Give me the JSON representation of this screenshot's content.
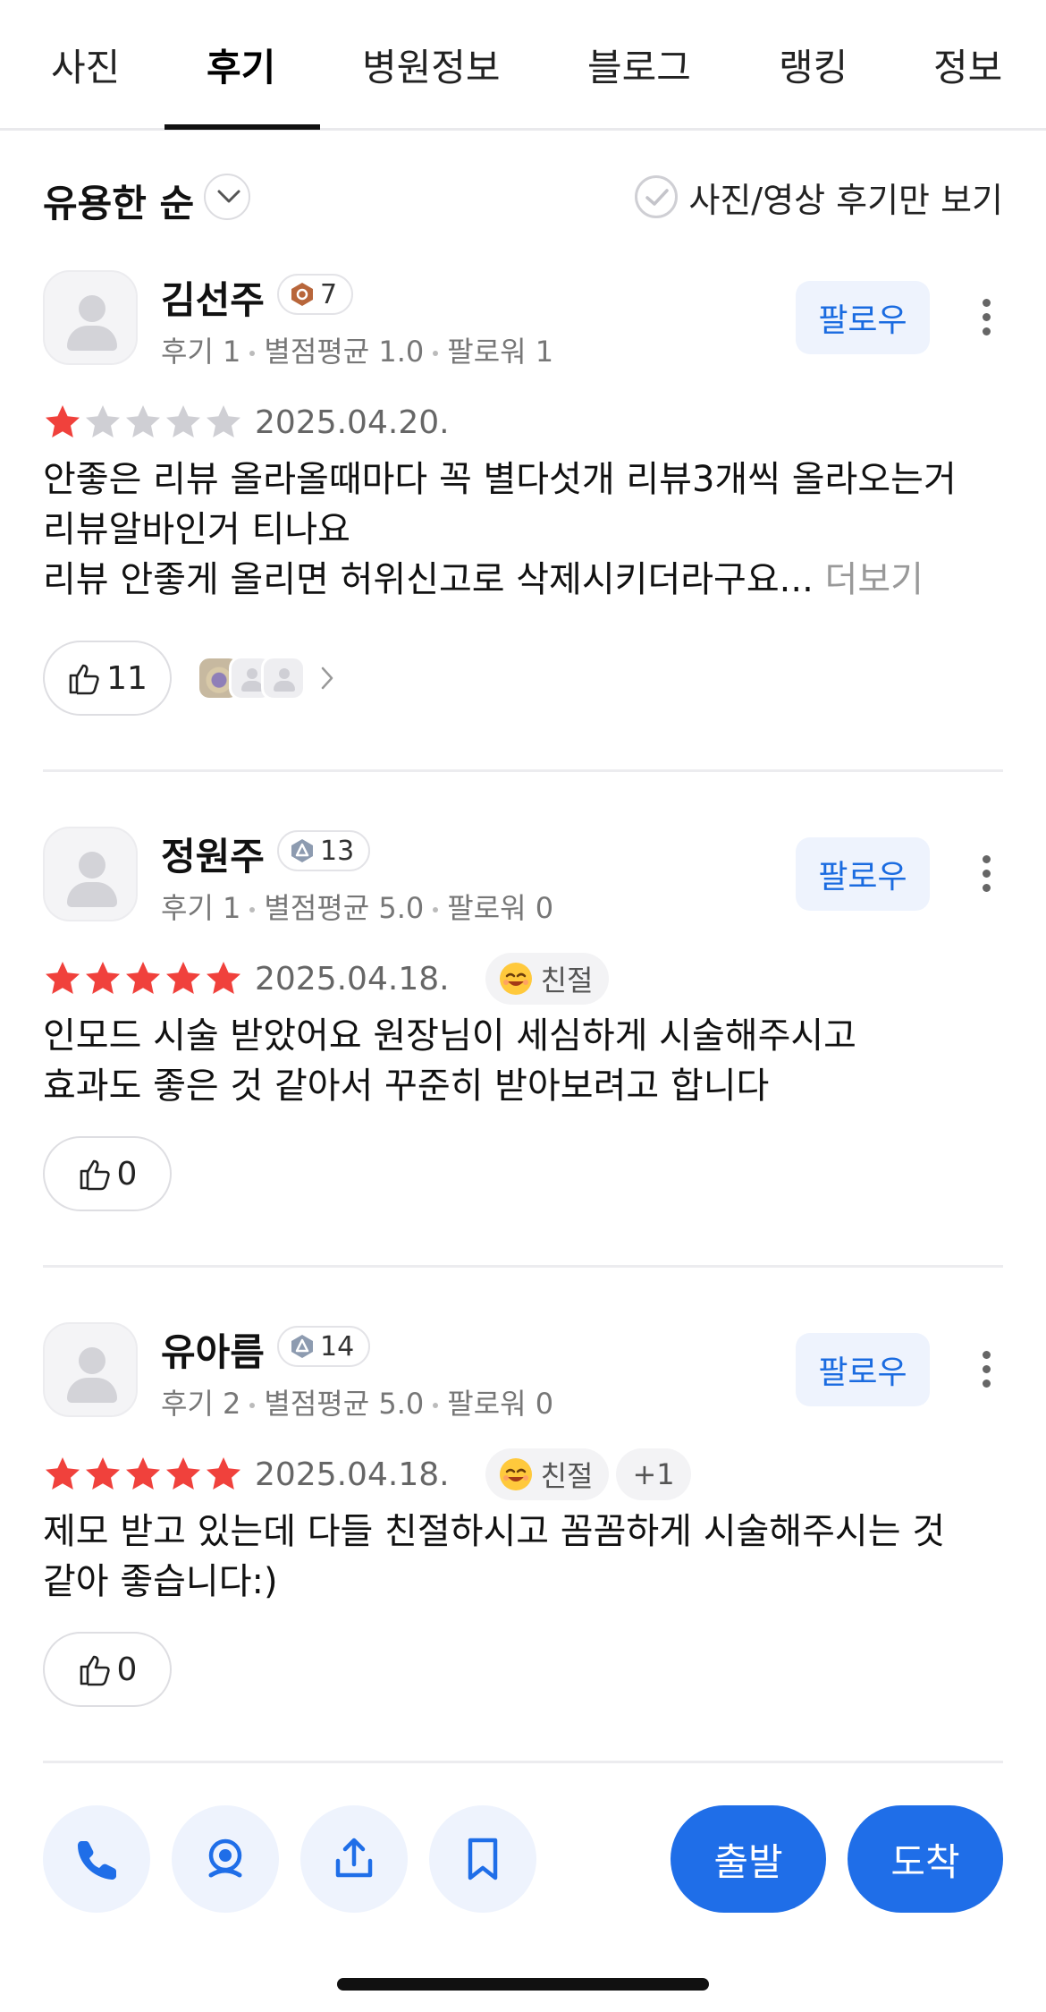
{
  "tabs": [
    {
      "label": "사진"
    },
    {
      "label": "후기"
    },
    {
      "label": "병원정보"
    },
    {
      "label": "블로그"
    },
    {
      "label": "랭킹"
    },
    {
      "label": "정보"
    }
  ],
  "active_tab": "후기",
  "sort": {
    "label": "유용한 순"
  },
  "photo_filter": {
    "label": "사진/영상 후기만 보기",
    "checked": false
  },
  "colors": {
    "accent": "#1f6ee8",
    "star_on": "#f0413c",
    "star_off": "#cfcfd4"
  },
  "reviews": [
    {
      "name": "김선주",
      "level": "7",
      "level_icon": "bronze-hexagon-icon",
      "stats": {
        "reviews": "후기 1",
        "avg": "별점평균 1.0",
        "followers": "팔로워 1"
      },
      "follow_label": "팔로우",
      "rating": 1,
      "date": "2025.04.20.",
      "keywords": [],
      "text_lines": [
        "안좋은 리뷰 올라올때마다 꼭 별다섯개 리뷰3개씩 올라오는거",
        " 리뷰알바인거 티나요",
        "리뷰 안좋게 올리면 허위신고로 삭제시키더라구요..."
      ],
      "more_label": "더보기",
      "likes": "11",
      "likers_shown": true
    },
    {
      "name": "정원주",
      "level": "13",
      "level_icon": "silver-hexagon-icon",
      "stats": {
        "reviews": "후기 1",
        "avg": "별점평균 5.0",
        "followers": "팔로워 0"
      },
      "follow_label": "팔로우",
      "rating": 5,
      "date": "2025.04.18.",
      "keywords": [
        {
          "emoji": "smiling-face-icon",
          "label": "친절"
        }
      ],
      "text_lines": [
        "인모드 시술 받았어요 원장님이 세심하게 시술해주시고",
        "효과도 좋은 것 같아서 꾸준히 받아보려고 합니다"
      ],
      "likes": "0"
    },
    {
      "name": "유아름",
      "level": "14",
      "level_icon": "silver-hexagon-icon",
      "stats": {
        "reviews": "후기 2",
        "avg": "별점평균 5.0",
        "followers": "팔로워 0"
      },
      "follow_label": "팔로우",
      "rating": 5,
      "date": "2025.04.18.",
      "keywords": [
        {
          "emoji": "smiling-face-icon",
          "label": "친절"
        }
      ],
      "keywords_more": "+1",
      "text_lines": [
        "제모 받고 있는데 다들 친절하시고 꼼꼼하게 시술해주시는 것",
        "같아 좋습니다:)"
      ],
      "likes": "0"
    }
  ],
  "actions": {
    "icons": [
      "phone-icon",
      "street-view-icon",
      "share-icon",
      "bookmark-icon"
    ],
    "depart_label": "출발",
    "arrive_label": "도착"
  }
}
